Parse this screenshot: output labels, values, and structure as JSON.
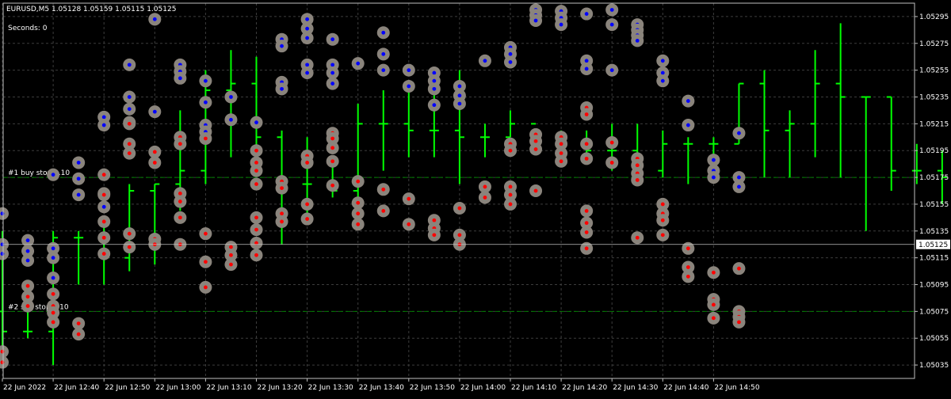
{
  "header": {
    "symbol_info": "EURUSD,M5  1.05128 1.05159 1.05115 1.05125",
    "seconds": "Seconds: 0"
  },
  "orders": [
    {
      "label": "#1 buy stop 0.10",
      "price": 1.05175
    },
    {
      "label": "#2 sell stop 0.10",
      "price": 1.05075
    }
  ],
  "current_price": {
    "label": "1.05125",
    "value": 1.05125
  },
  "colors": {
    "background": "#000000",
    "bar": "#00ff00",
    "grid": "#3c3c3c",
    "axis": "#c0c0c0",
    "order_line": "#007a00",
    "marker_ring": "#8a847c",
    "marker_buy": "#0000ff",
    "marker_sell": "#ff0000",
    "price_line": "#c0c0c0"
  },
  "chart_data": {
    "type": "ohlc",
    "title": "EURUSD,M5",
    "ylim": [
      1.05025,
      1.05305
    ],
    "y_ticks": [
      "1.05295",
      "1.05275",
      "1.05255",
      "1.05235",
      "1.05215",
      "1.05195",
      "1.05175",
      "1.05155",
      "1.05135",
      "1.05115",
      "1.05095",
      "1.05075",
      "1.05055",
      "1.05035"
    ],
    "x_ticks": [
      "22 Jun 2022",
      "22 Jun 12:40",
      "22 Jun 12:50",
      "22 Jun 13:00",
      "22 Jun 13:10",
      "22 Jun 13:20",
      "22 Jun 13:30",
      "22 Jun 13:40",
      "22 Jun 13:50",
      "22 Jun 14:00",
      "22 Jun 14:10",
      "22 Jun 14:20",
      "22 Jun 14:30",
      "22 Jun 14:40",
      "22 Jun 14:50"
    ],
    "bars": [
      {
        "o": 1.05075,
        "h": 1.05135,
        "l": 1.0504,
        "c": 1.0506
      },
      {
        "o": 1.0506,
        "h": 1.0508,
        "l": 1.05055,
        "c": 1.0506
      },
      {
        "o": 1.0506,
        "h": 1.05135,
        "l": 1.05035,
        "c": 1.0513
      },
      {
        "o": 1.0513,
        "h": 1.05135,
        "l": 1.05095,
        "c": 1.0513
      },
      {
        "o": 1.0513,
        "h": 1.0514,
        "l": 1.05095,
        "c": 1.05115
      },
      {
        "o": 1.05115,
        "h": 1.0517,
        "l": 1.05105,
        "c": 1.05165
      },
      {
        "o": 1.05165,
        "h": 1.0517,
        "l": 1.0511,
        "c": 1.0517
      },
      {
        "o": 1.0517,
        "h": 1.05225,
        "l": 1.0515,
        "c": 1.0518
      },
      {
        "o": 1.0518,
        "h": 1.05255,
        "l": 1.0517,
        "c": 1.0524
      },
      {
        "o": 1.0524,
        "h": 1.0527,
        "l": 1.0519,
        "c": 1.05245
      },
      {
        "o": 1.05245,
        "h": 1.05265,
        "l": 1.0519,
        "c": 1.05205
      },
      {
        "o": 1.05205,
        "h": 1.0521,
        "l": 1.05125,
        "c": 1.0517
      },
      {
        "o": 1.0517,
        "h": 1.05205,
        "l": 1.05145,
        "c": 1.0517
      },
      {
        "o": 1.0517,
        "h": 1.0519,
        "l": 1.0516,
        "c": 1.05165
      },
      {
        "o": 1.05165,
        "h": 1.0523,
        "l": 1.0516,
        "c": 1.05215
      },
      {
        "o": 1.05215,
        "h": 1.0524,
        "l": 1.0518,
        "c": 1.05215
      },
      {
        "o": 1.05215,
        "h": 1.05245,
        "l": 1.0519,
        "c": 1.0521
      },
      {
        "o": 1.0521,
        "h": 1.05255,
        "l": 1.0519,
        "c": 1.0521
      },
      {
        "o": 1.0521,
        "h": 1.05255,
        "l": 1.0517,
        "c": 1.05205
      },
      {
        "o": 1.05205,
        "h": 1.05215,
        "l": 1.0519,
        "c": 1.05205
      },
      {
        "o": 1.05205,
        "h": 1.05225,
        "l": 1.05205,
        "c": 1.05215
      },
      {
        "o": 1.05215,
        "h": 1.0521,
        "l": 1.05195,
        "c": 1.052
      },
      {
        "o": 1.052,
        "h": 1.0521,
        "l": 1.0519,
        "c": 1.052
      },
      {
        "o": 1.052,
        "h": 1.0521,
        "l": 1.05185,
        "c": 1.05195
      },
      {
        "o": 1.05195,
        "h": 1.05215,
        "l": 1.0518,
        "c": 1.05195
      },
      {
        "o": 1.05195,
        "h": 1.05215,
        "l": 1.05175,
        "c": 1.0518
      },
      {
        "o": 1.0518,
        "h": 1.0521,
        "l": 1.05175,
        "c": 1.052
      },
      {
        "o": 1.052,
        "h": 1.05205,
        "l": 1.0517,
        "c": 1.052
      },
      {
        "o": 1.052,
        "h": 1.05205,
        "l": 1.05175,
        "c": 1.052
      },
      {
        "o": 1.052,
        "h": 1.05245,
        "l": 1.052,
        "c": 1.05245
      },
      {
        "o": 1.05245,
        "h": 1.05255,
        "l": 1.05175,
        "c": 1.0521
      },
      {
        "o": 1.0521,
        "h": 1.05225,
        "l": 1.05175,
        "c": 1.05215
      },
      {
        "o": 1.05215,
        "h": 1.0527,
        "l": 1.0519,
        "c": 1.05245
      },
      {
        "o": 1.05245,
        "h": 1.0529,
        "l": 1.05175,
        "c": 1.05235
      },
      {
        "o": 1.05235,
        "h": 1.05235,
        "l": 1.05135,
        "c": 1.05235
      },
      {
        "o": 1.05235,
        "h": 1.05235,
        "l": 1.05165,
        "c": 1.0518
      },
      {
        "o": 1.0518,
        "h": 1.052,
        "l": 1.0517,
        "c": 1.0518
      },
      {
        "o": 1.0518,
        "h": 1.05195,
        "l": 1.05155,
        "c": 1.05175
      },
      {
        "o": 1.05175,
        "h": 1.05195,
        "l": 1.05145,
        "c": 1.05175
      },
      {
        "o": 1.05175,
        "h": 1.05175,
        "l": 1.05125,
        "c": 1.05135
      },
      {
        "o": 1.05135,
        "h": 1.0515,
        "l": 1.0512,
        "c": 1.05125
      },
      {
        "o": 1.05125,
        "h": 1.05155,
        "l": 1.05115,
        "c": 1.05125
      }
    ],
    "markers_buy": [
      {
        "bar": 0,
        "y": 1.05148
      },
      {
        "bar": 0,
        "y": 1.05125
      },
      {
        "bar": 0,
        "y": 1.05118
      },
      {
        "bar": 1,
        "y": 1.05128
      },
      {
        "bar": 1,
        "y": 1.0512
      },
      {
        "bar": 1,
        "y": 1.05113
      },
      {
        "bar": 2,
        "y": 1.05177
      },
      {
        "bar": 2,
        "y": 1.05122
      },
      {
        "bar": 2,
        "y": 1.05115
      },
      {
        "bar": 2,
        "y": 1.051
      },
      {
        "bar": 3,
        "y": 1.05186
      },
      {
        "bar": 3,
        "y": 1.05174
      },
      {
        "bar": 3,
        "y": 1.05162
      },
      {
        "bar": 4,
        "y": 1.0522
      },
      {
        "bar": 4,
        "y": 1.05214
      },
      {
        "bar": 4,
        "y": 1.05163
      },
      {
        "bar": 4,
        "y": 1.05153
      },
      {
        "bar": 5,
        "y": 1.05259
      },
      {
        "bar": 5,
        "y": 1.05235
      },
      {
        "bar": 5,
        "y": 1.05226
      },
      {
        "bar": 5,
        "y": 1.05216
      },
      {
        "bar": 6,
        "y": 1.05293
      },
      {
        "bar": 6,
        "y": 1.05224
      },
      {
        "bar": 7,
        "y": 1.05259
      },
      {
        "bar": 7,
        "y": 1.05254
      },
      {
        "bar": 7,
        "y": 1.05249
      },
      {
        "bar": 8,
        "y": 1.05247
      },
      {
        "bar": 8,
        "y": 1.05231
      },
      {
        "bar": 8,
        "y": 1.05214
      },
      {
        "bar": 8,
        "y": 1.05209
      },
      {
        "bar": 9,
        "y": 1.05235
      },
      {
        "bar": 9,
        "y": 1.05218
      },
      {
        "bar": 10,
        "y": 1.05216
      },
      {
        "bar": 11,
        "y": 1.05278
      },
      {
        "bar": 11,
        "y": 1.05273
      },
      {
        "bar": 11,
        "y": 1.05246
      },
      {
        "bar": 11,
        "y": 1.05241
      },
      {
        "bar": 12,
        "y": 1.05293
      },
      {
        "bar": 12,
        "y": 1.05286
      },
      {
        "bar": 12,
        "y": 1.05279
      },
      {
        "bar": 12,
        "y": 1.05259
      },
      {
        "bar": 12,
        "y": 1.05253
      },
      {
        "bar": 13,
        "y": 1.05278
      },
      {
        "bar": 13,
        "y": 1.05259
      },
      {
        "bar": 13,
        "y": 1.05253
      },
      {
        "bar": 13,
        "y": 1.05245
      },
      {
        "bar": 14,
        "y": 1.0526
      },
      {
        "bar": 15,
        "y": 1.05283
      },
      {
        "bar": 15,
        "y": 1.05267
      },
      {
        "bar": 15,
        "y": 1.05255
      },
      {
        "bar": 16,
        "y": 1.05255
      },
      {
        "bar": 16,
        "y": 1.05243
      },
      {
        "bar": 17,
        "y": 1.05253
      },
      {
        "bar": 17,
        "y": 1.05247
      },
      {
        "bar": 17,
        "y": 1.05241
      },
      {
        "bar": 17,
        "y": 1.05229
      },
      {
        "bar": 18,
        "y": 1.05243
      },
      {
        "bar": 18,
        "y": 1.05236
      },
      {
        "bar": 18,
        "y": 1.0523
      },
      {
        "bar": 19,
        "y": 1.05262
      },
      {
        "bar": 20,
        "y": 1.05272
      },
      {
        "bar": 20,
        "y": 1.05267
      },
      {
        "bar": 20,
        "y": 1.05261
      },
      {
        "bar": 21,
        "y": 1.053
      },
      {
        "bar": 21,
        "y": 1.05296
      },
      {
        "bar": 21,
        "y": 1.05292
      },
      {
        "bar": 22,
        "y": 1.05299
      },
      {
        "bar": 22,
        "y": 1.05294
      },
      {
        "bar": 22,
        "y": 1.05289
      },
      {
        "bar": 23,
        "y": 1.05297
      },
      {
        "bar": 23,
        "y": 1.05262
      },
      {
        "bar": 23,
        "y": 1.05256
      },
      {
        "bar": 24,
        "y": 1.053
      },
      {
        "bar": 24,
        "y": 1.05289
      },
      {
        "bar": 24,
        "y": 1.05255
      },
      {
        "bar": 25,
        "y": 1.05289
      },
      {
        "bar": 25,
        "y": 1.05285
      },
      {
        "bar": 25,
        "y": 1.05281
      },
      {
        "bar": 25,
        "y": 1.05277
      },
      {
        "bar": 26,
        "y": 1.05262
      },
      {
        "bar": 26,
        "y": 1.05253
      },
      {
        "bar": 26,
        "y": 1.05247
      },
      {
        "bar": 27,
        "y": 1.05232
      },
      {
        "bar": 27,
        "y": 1.05214
      },
      {
        "bar": 28,
        "y": 1.05188
      },
      {
        "bar": 28,
        "y": 1.0518
      },
      {
        "bar": 28,
        "y": 1.05175
      },
      {
        "bar": 29,
        "y": 1.05208
      },
      {
        "bar": 29,
        "y": 1.05175
      },
      {
        "bar": 29,
        "y": 1.05168
      }
    ],
    "markers_sell": [
      {
        "bar": 0,
        "y": 1.05045
      },
      {
        "bar": 0,
        "y": 1.05037
      },
      {
        "bar": 1,
        "y": 1.05094
      },
      {
        "bar": 1,
        "y": 1.05086
      },
      {
        "bar": 1,
        "y": 1.05079
      },
      {
        "bar": 2,
        "y": 1.05088
      },
      {
        "bar": 2,
        "y": 1.05079
      },
      {
        "bar": 2,
        "y": 1.05074
      },
      {
        "bar": 2,
        "y": 1.05067
      },
      {
        "bar": 3,
        "y": 1.05066
      },
      {
        "bar": 3,
        "y": 1.05058
      },
      {
        "bar": 4,
        "y": 1.05177
      },
      {
        "bar": 4,
        "y": 1.05162
      },
      {
        "bar": 4,
        "y": 1.05142
      },
      {
        "bar": 4,
        "y": 1.0513
      },
      {
        "bar": 4,
        "y": 1.05118
      },
      {
        "bar": 5,
        "y": 1.05215
      },
      {
        "bar": 5,
        "y": 1.052
      },
      {
        "bar": 5,
        "y": 1.05193
      },
      {
        "bar": 5,
        "y": 1.05133
      },
      {
        "bar": 5,
        "y": 1.05123
      },
      {
        "bar": 6,
        "y": 1.05194
      },
      {
        "bar": 6,
        "y": 1.05186
      },
      {
        "bar": 6,
        "y": 1.05129
      },
      {
        "bar": 6,
        "y": 1.05125
      },
      {
        "bar": 7,
        "y": 1.05205
      },
      {
        "bar": 7,
        "y": 1.052
      },
      {
        "bar": 7,
        "y": 1.05163
      },
      {
        "bar": 7,
        "y": 1.05157
      },
      {
        "bar": 7,
        "y": 1.05145
      },
      {
        "bar": 7,
        "y": 1.05125
      },
      {
        "bar": 8,
        "y": 1.05204
      },
      {
        "bar": 8,
        "y": 1.05133
      },
      {
        "bar": 8,
        "y": 1.05112
      },
      {
        "bar": 8,
        "y": 1.05093
      },
      {
        "bar": 9,
        "y": 1.05123
      },
      {
        "bar": 9,
        "y": 1.05117
      },
      {
        "bar": 9,
        "y": 1.0511
      },
      {
        "bar": 10,
        "y": 1.05195
      },
      {
        "bar": 10,
        "y": 1.05186
      },
      {
        "bar": 10,
        "y": 1.0518
      },
      {
        "bar": 10,
        "y": 1.0517
      },
      {
        "bar": 10,
        "y": 1.05145
      },
      {
        "bar": 10,
        "y": 1.05136
      },
      {
        "bar": 10,
        "y": 1.05126
      },
      {
        "bar": 10,
        "y": 1.05117
      },
      {
        "bar": 11,
        "y": 1.05172
      },
      {
        "bar": 11,
        "y": 1.05167
      },
      {
        "bar": 11,
        "y": 1.05148
      },
      {
        "bar": 11,
        "y": 1.05142
      },
      {
        "bar": 12,
        "y": 1.05191
      },
      {
        "bar": 12,
        "y": 1.05186
      },
      {
        "bar": 12,
        "y": 1.05155
      },
      {
        "bar": 12,
        "y": 1.05144
      },
      {
        "bar": 13,
        "y": 1.05208
      },
      {
        "bar": 13,
        "y": 1.05204
      },
      {
        "bar": 13,
        "y": 1.05197
      },
      {
        "bar": 13,
        "y": 1.05187
      },
      {
        "bar": 13,
        "y": 1.05169
      },
      {
        "bar": 14,
        "y": 1.05172
      },
      {
        "bar": 14,
        "y": 1.05156
      },
      {
        "bar": 14,
        "y": 1.05148
      },
      {
        "bar": 14,
        "y": 1.0514
      },
      {
        "bar": 15,
        "y": 1.05166
      },
      {
        "bar": 15,
        "y": 1.0515
      },
      {
        "bar": 16,
        "y": 1.05159
      },
      {
        "bar": 16,
        "y": 1.0514
      },
      {
        "bar": 17,
        "y": 1.05143
      },
      {
        "bar": 17,
        "y": 1.05137
      },
      {
        "bar": 17,
        "y": 1.05132
      },
      {
        "bar": 18,
        "y": 1.05152
      },
      {
        "bar": 18,
        "y": 1.05132
      },
      {
        "bar": 18,
        "y": 1.05125
      },
      {
        "bar": 19,
        "y": 1.05168
      },
      {
        "bar": 19,
        "y": 1.0516
      },
      {
        "bar": 20,
        "y": 1.052
      },
      {
        "bar": 20,
        "y": 1.05195
      },
      {
        "bar": 20,
        "y": 1.05168
      },
      {
        "bar": 20,
        "y": 1.05162
      },
      {
        "bar": 20,
        "y": 1.05155
      },
      {
        "bar": 21,
        "y": 1.05207
      },
      {
        "bar": 21,
        "y": 1.05202
      },
      {
        "bar": 21,
        "y": 1.05196
      },
      {
        "bar": 21,
        "y": 1.05165
      },
      {
        "bar": 22,
        "y": 1.05205
      },
      {
        "bar": 22,
        "y": 1.052
      },
      {
        "bar": 22,
        "y": 1.05193
      },
      {
        "bar": 22,
        "y": 1.05187
      },
      {
        "bar": 23,
        "y": 1.05227
      },
      {
        "bar": 23,
        "y": 1.05222
      },
      {
        "bar": 23,
        "y": 1.052
      },
      {
        "bar": 23,
        "y": 1.05189
      },
      {
        "bar": 23,
        "y": 1.0515
      },
      {
        "bar": 23,
        "y": 1.05141
      },
      {
        "bar": 23,
        "y": 1.05134
      },
      {
        "bar": 23,
        "y": 1.05122
      },
      {
        "bar": 24,
        "y": 1.05201
      },
      {
        "bar": 24,
        "y": 1.05186
      },
      {
        "bar": 25,
        "y": 1.05189
      },
      {
        "bar": 25,
        "y": 1.05184
      },
      {
        "bar": 25,
        "y": 1.05178
      },
      {
        "bar": 25,
        "y": 1.05173
      },
      {
        "bar": 25,
        "y": 1.0513
      },
      {
        "bar": 26,
        "y": 1.05155
      },
      {
        "bar": 26,
        "y": 1.05148
      },
      {
        "bar": 26,
        "y": 1.05143
      },
      {
        "bar": 26,
        "y": 1.05132
      },
      {
        "bar": 27,
        "y": 1.05122
      },
      {
        "bar": 27,
        "y": 1.05108
      },
      {
        "bar": 27,
        "y": 1.05101
      },
      {
        "bar": 28,
        "y": 1.05104
      },
      {
        "bar": 28,
        "y": 1.05084
      },
      {
        "bar": 28,
        "y": 1.0508
      },
      {
        "bar": 28,
        "y": 1.0507
      },
      {
        "bar": 29,
        "y": 1.05107
      },
      {
        "bar": 29,
        "y": 1.05075
      },
      {
        "bar": 29,
        "y": 1.05071
      },
      {
        "bar": 29,
        "y": 1.05067
      }
    ]
  }
}
